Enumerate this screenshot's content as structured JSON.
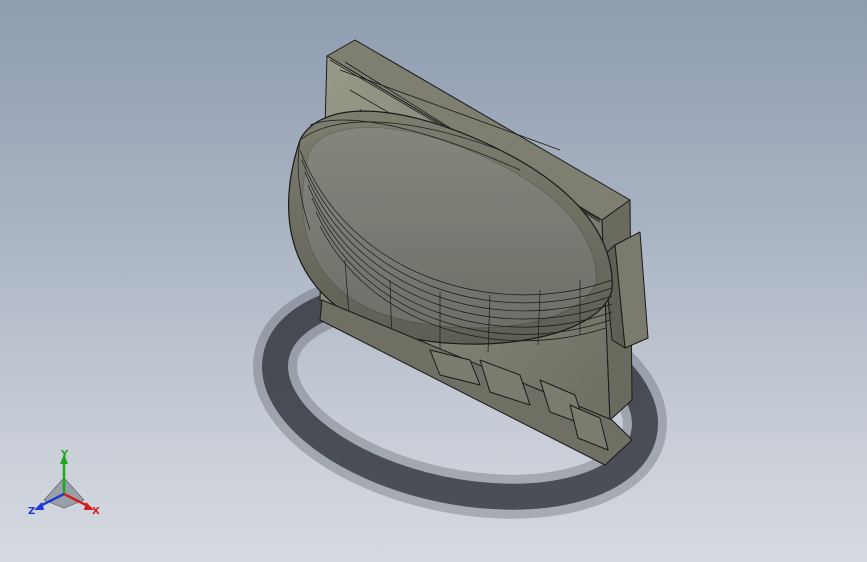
{
  "viewport": {
    "background_top": "#8f9cb0",
    "background_bottom": "#d6dae1",
    "model_face_color": "#8a8a7c",
    "model_edge_color": "#1a1a1a",
    "shadow_color": "#2c2f36"
  },
  "triad": {
    "x_label": "X",
    "y_label": "Y",
    "z_label": "Z",
    "x_color": "#d21e1e",
    "y_color": "#1ea81e",
    "z_color": "#1e3cd2"
  }
}
